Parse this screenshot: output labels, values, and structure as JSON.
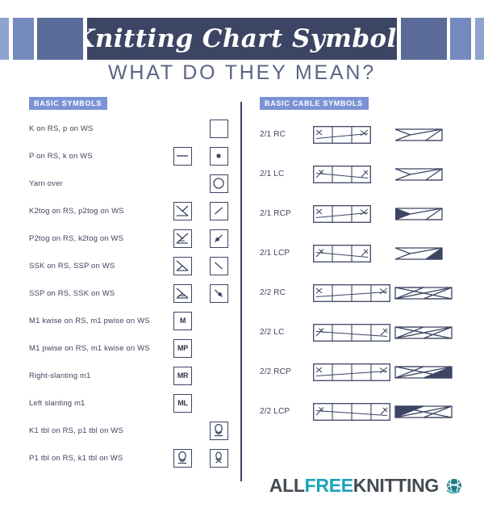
{
  "header": {
    "title": "Knitting Chart Symbols",
    "subtitle": "WHAT DO THEY MEAN?",
    "banner_bg": "#3d4565",
    "bar_colors": [
      "#8fa3d0",
      "#7489bd",
      "#5b6b99"
    ]
  },
  "colors": {
    "ink": "#3d4565",
    "badge_bg": "#7b93d4",
    "text": "#3f465c",
    "logo_teal": "#1ba3b8",
    "logo_dark": "#444b52"
  },
  "basic": {
    "section_title": "BASIC SYMBOLS",
    "rows": [
      {
        "label": "K on RS, p on WS",
        "sym_a": "none",
        "sym_b": "blank"
      },
      {
        "label": "P on RS, k on WS",
        "sym_a": "dash",
        "sym_b": "dot"
      },
      {
        "label": "Yarn over",
        "sym_a": "none",
        "sym_b": "circle"
      },
      {
        "label": "K2tog on RS, p2tog on WS",
        "sym_a": "k2tog-big",
        "sym_b": "slash-right"
      },
      {
        "label": "P2tog on RS, k2tog on WS",
        "sym_a": "p2tog-big",
        "sym_b": "slash-right-dot"
      },
      {
        "label": "SSK on RS, SSP on WS",
        "sym_a": "ssk-big",
        "sym_b": "slash-left"
      },
      {
        "label": "SSP on RS, SSK on WS",
        "sym_a": "ssp-big",
        "sym_b": "slash-left-dot"
      },
      {
        "label": "M1 kwise on RS, m1 pwise on WS",
        "sym_a": "text:M",
        "sym_b": "none"
      },
      {
        "label": "M1 pwise on RS, m1 kwise on WS",
        "sym_a": "text:MP",
        "sym_b": "none"
      },
      {
        "label": "Right-slanting m1",
        "sym_a": "text:MR",
        "sym_b": "none"
      },
      {
        "label": "Left slanting m1",
        "sym_a": "text:ML",
        "sym_b": "none"
      },
      {
        "label": "K1 tbl on RS, p1 tbl on WS",
        "sym_a": "none",
        "sym_b": "tbl"
      },
      {
        "label": "P1 tbl on RS, k1 tbl on WS",
        "sym_a": "tbl",
        "sym_b": "tbl-small"
      }
    ]
  },
  "cable": {
    "section_title": "BASIC CABLE SYMBOLS",
    "rows": [
      {
        "label": "2/1 RC",
        "grid": "rc3",
        "ribbon": "rc3-ribbon"
      },
      {
        "label": "2/1 LC",
        "grid": "lc3",
        "ribbon": "lc3-ribbon"
      },
      {
        "label": "2/1 RCP",
        "grid": "rc3",
        "ribbon": "rcp3-ribbon"
      },
      {
        "label": "2/1 LCP",
        "grid": "lc3",
        "ribbon": "lcp3-ribbon"
      },
      {
        "label": "2/2 RC",
        "grid": "rc4",
        "ribbon": "rc4-ribbon"
      },
      {
        "label": "2/2 LC",
        "grid": "lc4",
        "ribbon": "lc4-ribbon"
      },
      {
        "label": "2/2 RCP",
        "grid": "rc4",
        "ribbon": "rcp4-ribbon"
      },
      {
        "label": "2/2 LCP",
        "grid": "lc4",
        "ribbon": "lcp4-ribbon"
      }
    ]
  },
  "footer": {
    "logo_part1": "ALL",
    "logo_part2": "FREE",
    "logo_part3": "KNITTING",
    "logo_icon": "yarn-ball-icon"
  }
}
